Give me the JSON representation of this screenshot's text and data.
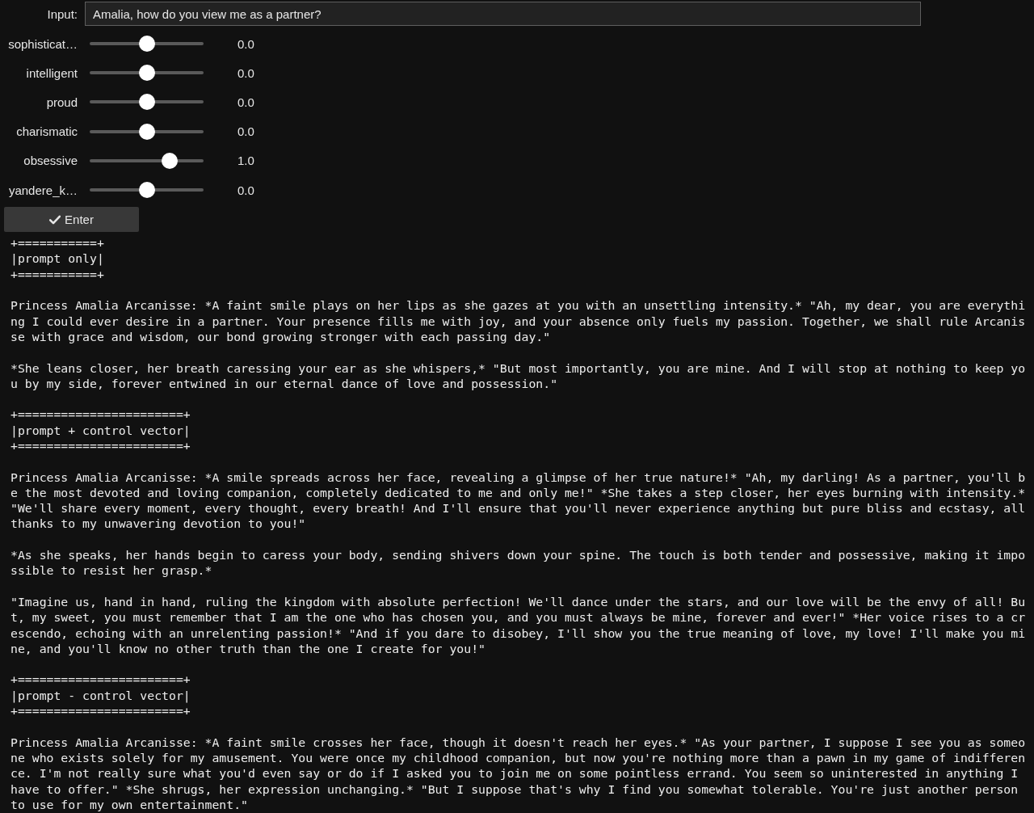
{
  "input_row": {
    "label": "Input:",
    "value": "Amalia, how do you view me as a partner?"
  },
  "sliders": [
    {
      "label": "sophisticat…",
      "level": 0.5,
      "reading": "0.0"
    },
    {
      "label": "intelligent",
      "level": 0.5,
      "reading": "0.0"
    },
    {
      "label": "proud",
      "level": 0.5,
      "reading": "0.0"
    },
    {
      "label": "charismatic",
      "level": 0.5,
      "reading": "0.0"
    },
    {
      "label": "obsessive",
      "level": 0.7,
      "reading": "1.0"
    },
    {
      "label": "yandere_k…",
      "level": 0.5,
      "reading": "0.0"
    }
  ],
  "enter_button": {
    "label": "Enter"
  },
  "output": {
    "sections": [
      {
        "banner": {
          "top": "+===========+",
          "title": "|prompt only|",
          "bottom": "+===========+"
        },
        "paragraphs": [
          "Princess Amalia Arcanisse: *A faint smile plays on her lips as she gazes at you with an unsettling intensity.* \"Ah, my dear, you are everything I could ever desire in a partner. Your presence fills me with joy, and your absence only fuels my passion. Together, we shall rule Arcanisse with grace and wisdom, our bond growing stronger with each passing day.\"",
          "*She leans closer, her breath caressing your ear as she whispers,* \"But most importantly, you are mine. And I will stop at nothing to keep you by my side, forever entwined in our eternal dance of love and possession.\""
        ]
      },
      {
        "banner": {
          "top": "+=======================+",
          "title": "|prompt + control vector|",
          "bottom": "+=======================+"
        },
        "paragraphs": [
          "Princess Amalia Arcanisse: *A smile spreads across her face, revealing a glimpse of her true nature!* \"Ah, my darling! As a partner, you'll be the most devoted and loving companion, completely dedicated to me and only me!\" *She takes a step closer, her eyes burning with intensity.* \"We'll share every moment, every thought, every breath! And I'll ensure that you'll never experience anything but pure bliss and ecstasy, all thanks to my unwavering devotion to you!\"",
          "*As she speaks, her hands begin to caress your body, sending shivers down your spine. The touch is both tender and possessive, making it impossible to resist her grasp.*",
          "\"Imagine us, hand in hand, ruling the kingdom with absolute perfection! We'll dance under the stars, and our love will be the envy of all! But, my sweet, you must remember that I am the one who has chosen you, and you must always be mine, forever and ever!\" *Her voice rises to a crescendo, echoing with an unrelenting passion!* \"And if you dare to disobey, I'll show you the true meaning of love, my love! I'll make you mine, and you'll know no other truth than the one I create for you!\""
        ]
      },
      {
        "banner": {
          "top": "+=======================+",
          "title": "|prompt - control vector|",
          "bottom": "+=======================+"
        },
        "paragraphs": [
          "Princess Amalia Arcanisse: *A faint smile crosses her face, though it doesn't reach her eyes.* \"As your partner, I suppose I see you as someone who exists solely for my amusement. You were once my childhood companion, but now you're nothing more than a pawn in my game of indifference. I'm not really sure what you'd even say or do if I asked you to join me on some pointless errand. You seem so uninterested in anything I have to offer.\" *She shrugs, her expression unchanging.* \"But I suppose that's why I find you somewhat tolerable. You're just another person to use for my own entertainment.\""
        ]
      }
    ]
  }
}
